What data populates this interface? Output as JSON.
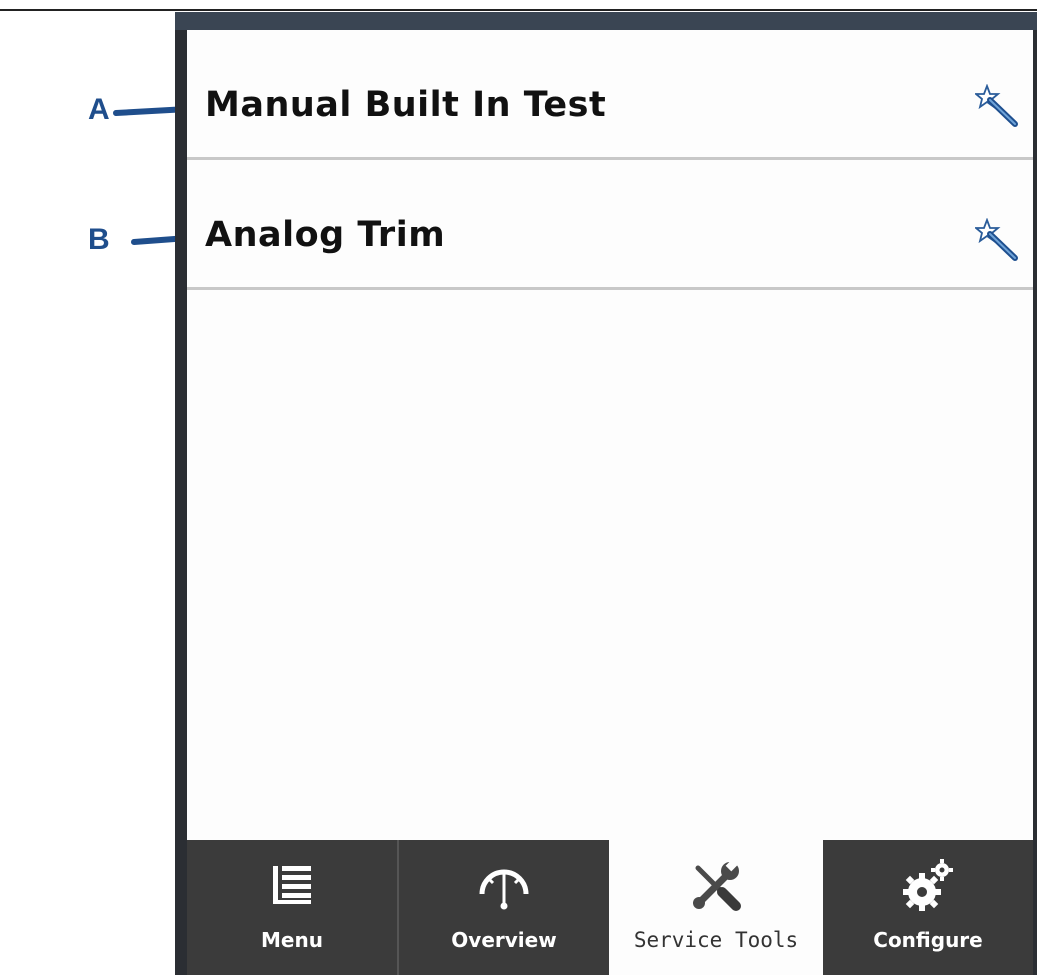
{
  "callouts": [
    {
      "letter": "A"
    },
    {
      "letter": "B"
    }
  ],
  "list": {
    "items": [
      {
        "label": "Manual Built In Test",
        "icon": "wizard-wand-icon"
      },
      {
        "label": "Analog Trim",
        "icon": "wizard-wand-icon"
      }
    ]
  },
  "tabs": [
    {
      "label": "Menu",
      "icon": "menu-list-icon",
      "active": false
    },
    {
      "label": "Overview",
      "icon": "gauge-icon",
      "active": false
    },
    {
      "label": "Service Tools",
      "icon": "wrench-screwdriver-icon",
      "active": true
    },
    {
      "label": "Configure",
      "icon": "gears-icon",
      "active": false
    }
  ],
  "colors": {
    "callout": "#1f4e8c",
    "frame": "#2b2e33",
    "tab_inactive": "#3b3b3b",
    "tab_active": "#fdfdfd"
  }
}
